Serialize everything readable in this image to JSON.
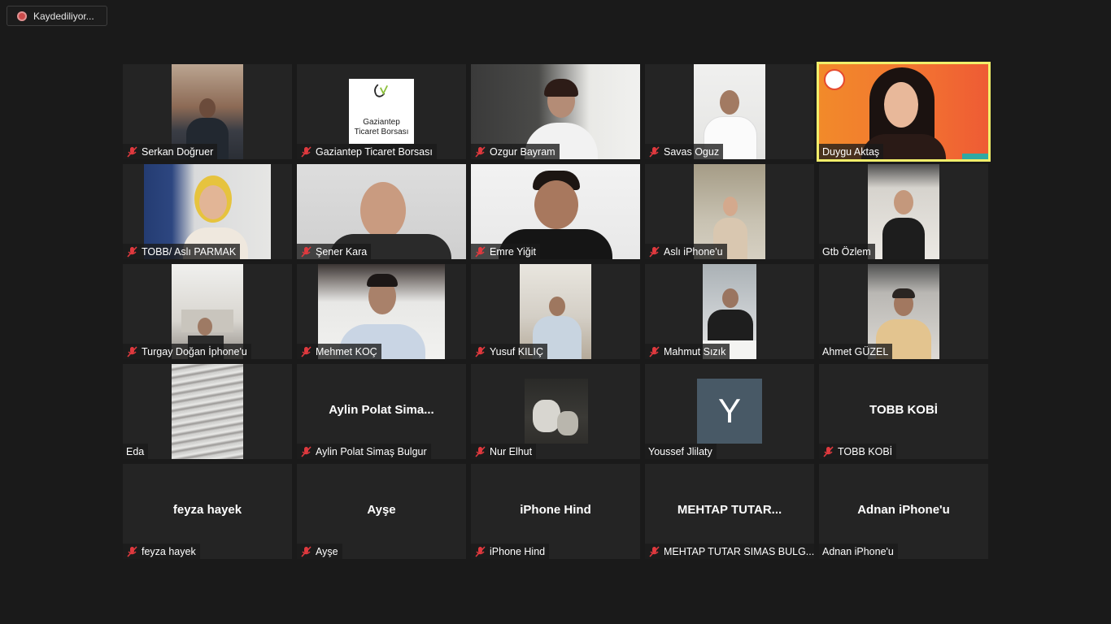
{
  "recording": {
    "label": "Kaydediliyor..."
  },
  "participants": [
    {
      "name": "Serkan Doğruer",
      "muted": true,
      "video": true
    },
    {
      "name": "Gaziantep Ticaret Borsası",
      "muted": true,
      "video": true,
      "logo_line1": "Gaziantep",
      "logo_line2": "Ticaret Borsası"
    },
    {
      "name": "Ozgur Bayram",
      "muted": true,
      "video": true
    },
    {
      "name": "Savas Oguz",
      "muted": true,
      "video": true
    },
    {
      "name": "Duygu Aktaş",
      "muted": false,
      "video": true,
      "active_speaker": true
    },
    {
      "name": "TOBB/ Aslı PARMAK",
      "muted": true,
      "video": true
    },
    {
      "name": "Şener Kara",
      "muted": true,
      "video": true
    },
    {
      "name": "Emre Yiğit",
      "muted": true,
      "video": true
    },
    {
      "name": "Aslı iPhone'u",
      "muted": true,
      "video": true
    },
    {
      "name": "Gtb Özlem",
      "muted": false,
      "video": true
    },
    {
      "name": "Turgay Doğan İphone'u",
      "muted": true,
      "video": true
    },
    {
      "name": "Mehmet KOÇ",
      "muted": true,
      "video": true
    },
    {
      "name": "Yusuf KILIÇ",
      "muted": true,
      "video": true
    },
    {
      "name": "Mahmut Sızık",
      "muted": true,
      "video": true
    },
    {
      "name": "Ahmet GÜZEL",
      "muted": false,
      "video": true
    },
    {
      "name": "Eda",
      "muted": false,
      "video": true
    },
    {
      "name": "Aylin Polat Simaş Bulgur",
      "display": "Aylin Polat Sima...",
      "muted": true,
      "video": false
    },
    {
      "name": "Nur Elhut",
      "muted": true,
      "video": true
    },
    {
      "name": "Youssef Jlilaty",
      "muted": false,
      "video": false,
      "avatar_letter": "Y"
    },
    {
      "name": "TOBB KOBİ",
      "display": "TOBB KOBİ",
      "muted": true,
      "video": false
    },
    {
      "name": "feyza hayek",
      "display": "feyza hayek",
      "muted": true,
      "video": false
    },
    {
      "name": "Ayşe",
      "display": "Ayşe",
      "muted": true,
      "video": false
    },
    {
      "name": "iPhone Hind",
      "display": "iPhone Hind",
      "muted": true,
      "video": false
    },
    {
      "name": "MEHTAP TUTAR SIMAS BULG...",
      "display": "MEHTAP TUTAR...",
      "muted": true,
      "video": false
    },
    {
      "name": "Adnan iPhone'u",
      "display": "Adnan iPhone'u",
      "muted": false,
      "video": false
    }
  ],
  "colors": {
    "background": "#1a1a1a",
    "tile": "#242424",
    "active_speaker_border": "#f1ee6a",
    "muted_icon": "#e0393e",
    "avatar_bg": "#485966"
  }
}
